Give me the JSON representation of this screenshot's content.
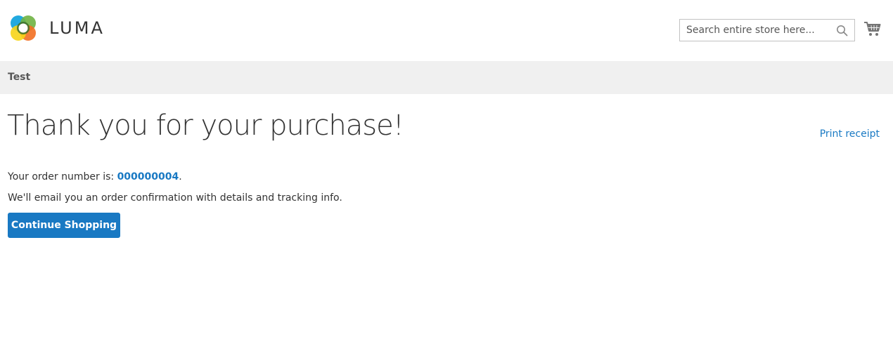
{
  "header": {
    "logo_text": "LUMA",
    "search": {
      "placeholder": "Search entire store here...",
      "value": ""
    },
    "cart_icon": "shopping-cart-icon",
    "search_icon": "magnifier-icon"
  },
  "nav": {
    "items": [
      {
        "label": "Test"
      }
    ]
  },
  "main": {
    "title": "Thank you for your purchase!",
    "print_label": "Print receipt",
    "order_prefix": "Your order number is: ",
    "order_number": "000000004",
    "order_suffix": ".",
    "email_message": "We'll email you an order confirmation with details and tracking info.",
    "continue_label": "Continue Shopping"
  },
  "colors": {
    "accent": "#1979c3",
    "nav_background": "#f0f0f0",
    "text": "#333333",
    "logo_orange": "#f26f21",
    "logo_yellow": "#f7d417",
    "logo_blue": "#0aa0dc",
    "logo_green": "#6fb342"
  }
}
